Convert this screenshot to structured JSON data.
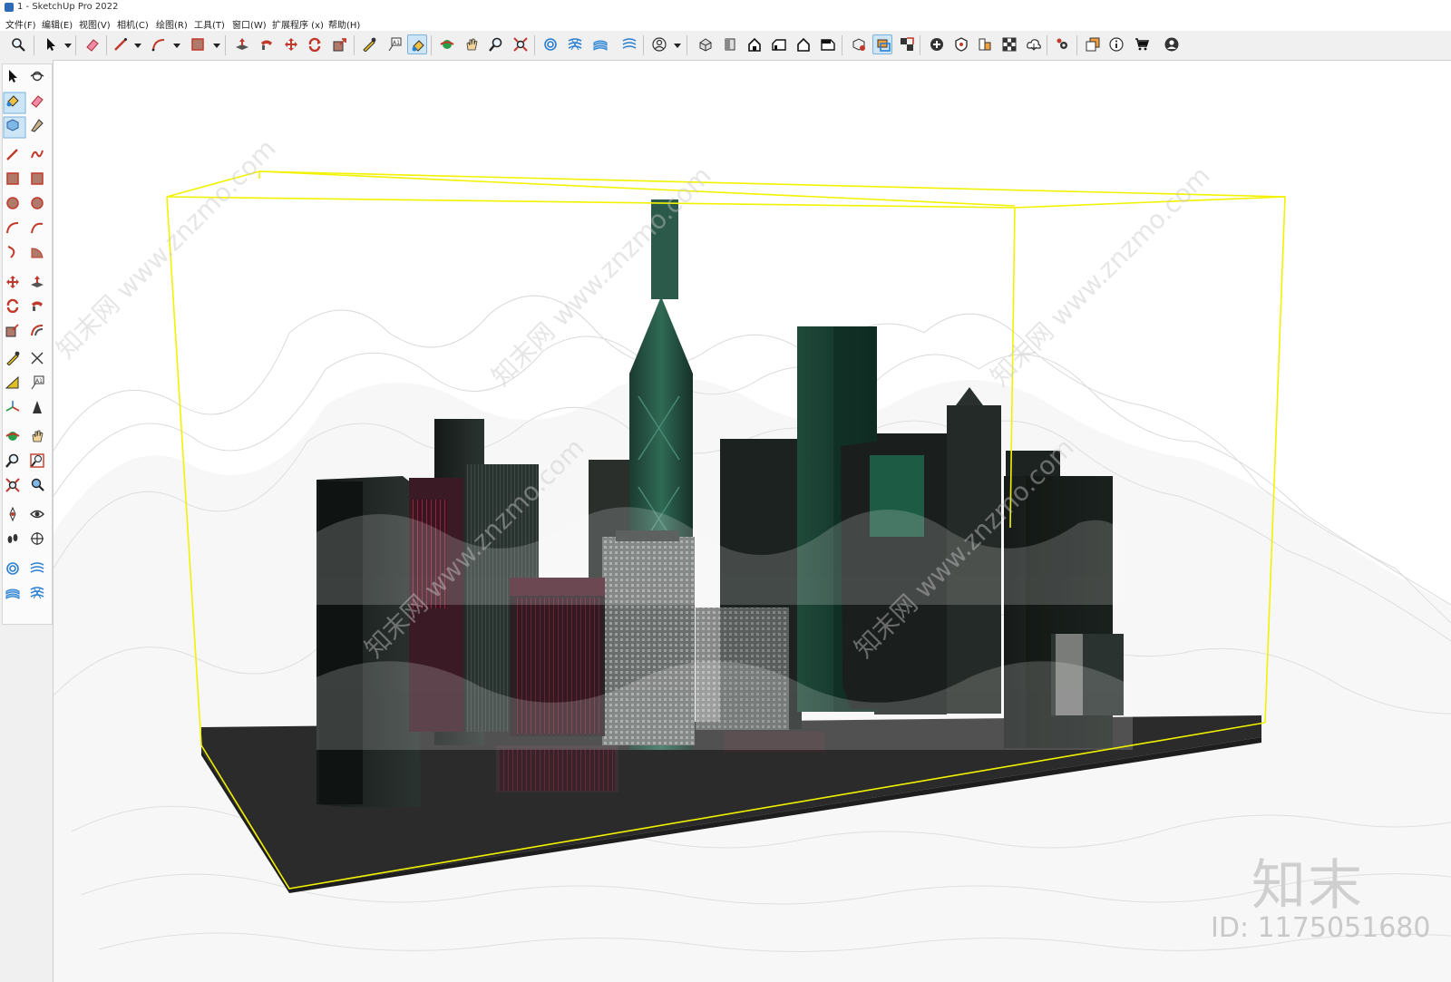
{
  "window": {
    "title": "1 - SketchUp Pro 2022"
  },
  "menubar": {
    "items": [
      {
        "label": "文件(F)"
      },
      {
        "label": "编辑(E)"
      },
      {
        "label": "视图(V)"
      },
      {
        "label": "相机(C)"
      },
      {
        "label": "绘图(R)"
      },
      {
        "label": "工具(T)"
      },
      {
        "label": "窗口(W)"
      },
      {
        "label": "扩展程序 (x)"
      },
      {
        "label": "帮助(H)"
      }
    ]
  },
  "toolbar": {
    "icons": [
      "zoom-icon",
      "select-icon",
      "eraser-icon",
      "line-icon",
      "arc-icon",
      "rectangle-icon",
      "push-pull-icon",
      "follow-me-icon",
      "move-icon",
      "rotate-icon",
      "scale-icon",
      "tape-measure-icon",
      "text-icon",
      "paint-bucket-icon",
      "orbit-icon",
      "pan-icon",
      "zoom-window-icon",
      "zoom-extents-icon",
      "sandbox-from-contours-icon",
      "sandbox-from-scratch-icon",
      "sandbox-smoove-icon",
      "sandbox-stamp-icon",
      "user-account-icon",
      "iso-view-icon",
      "top-view-icon",
      "front-view-icon",
      "right-view-icon",
      "back-view-icon",
      "left-view-icon",
      "components-icon",
      "section-plane-icon",
      "section-cut-icon",
      "add-location-icon",
      "geo-location-icon",
      "styles-icon",
      "materials-icon",
      "warehouse-icon",
      "extension-manager-icon",
      "layout-icon",
      "info-icon",
      "shop-icon",
      "profile-icon"
    ],
    "active": "paint-bucket-icon"
  },
  "left_toolbar": {
    "icons": [
      "select-icon",
      "orbit-icon",
      "paint-bucket-icon",
      "eraser-icon",
      "component-icon",
      "tag-icon",
      "line-icon",
      "freehand-icon",
      "rectangle-icon",
      "rotated-rectangle-icon",
      "circle-icon",
      "polygon-icon",
      "arc-icon",
      "2pt-arc-icon",
      "3pt-arc-icon",
      "pie-icon",
      "move-icon",
      "push-pull-icon",
      "rotate-icon",
      "follow-me-icon",
      "scale-icon",
      "offset-icon",
      "tape-measure-icon",
      "dimension-icon",
      "protractor-icon",
      "text-icon",
      "axes-icon",
      "3d-text-icon",
      "orbit2-icon",
      "pan-icon",
      "zoom-icon",
      "zoom-window-icon",
      "zoom-extents-icon",
      "previous-view-icon",
      "position-camera-icon",
      "look-around-icon",
      "walk-icon",
      "section-plane-icon",
      "sandbox-contours-icon",
      "sandbox-scratch-icon",
      "sandbox-smoove-icon",
      "sandbox-flip-icon"
    ],
    "active": "paint-bucket-icon"
  },
  "watermark": {
    "text": "知末网 www.znzmo.com",
    "logo": "知末",
    "id": "ID: 1175051680"
  },
  "colors": {
    "selection_box": "#f2f200",
    "ground": "#2b2b2b",
    "accent_active": "#cde6f7"
  }
}
